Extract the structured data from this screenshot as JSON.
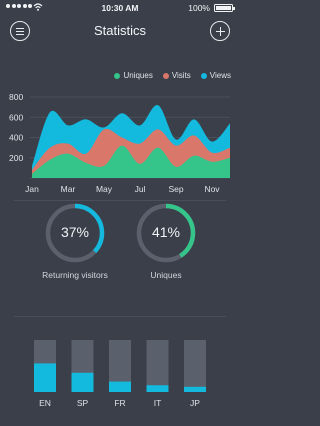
{
  "status_bar": {
    "time": "10:30 AM",
    "battery": "100%"
  },
  "nav": {
    "title": "Statistics"
  },
  "colors": {
    "background": "#3a3f4a",
    "uniques": "#35c48a",
    "visits": "#d9776a",
    "views": "#14b9de",
    "track": "#5b616c"
  },
  "legend": [
    {
      "label": "Uniques",
      "color": "#35c48a"
    },
    {
      "label": "Visits",
      "color": "#d9776a"
    },
    {
      "label": "Views",
      "color": "#14b9de"
    }
  ],
  "chart_data": [
    {
      "type": "area",
      "x_tick_labels": [
        "Jan",
        "Mar",
        "May",
        "Jul",
        "Sep",
        "Nov"
      ],
      "y_tick_labels": [
        "200",
        "400",
        "600",
        "800"
      ],
      "ylim": [
        0,
        850
      ],
      "x": [
        0,
        1,
        2,
        3,
        4,
        5,
        6,
        7,
        8,
        9,
        10,
        11
      ],
      "series": [
        {
          "name": "Views",
          "color": "#14b9de",
          "values": [
            120,
            650,
            520,
            580,
            500,
            640,
            520,
            720,
            380,
            580,
            360,
            540
          ]
        },
        {
          "name": "Visits",
          "color": "#d9776a",
          "values": [
            80,
            300,
            340,
            240,
            480,
            400,
            340,
            480,
            320,
            420,
            250,
            300
          ]
        },
        {
          "name": "Uniques",
          "color": "#35c48a",
          "values": [
            40,
            180,
            240,
            150,
            120,
            320,
            140,
            300,
            110,
            220,
            160,
            200
          ]
        }
      ],
      "grid": true
    },
    {
      "type": "donut",
      "label": "Returning visitors",
      "value": 37,
      "display": "37%"
    },
    {
      "type": "donut",
      "label": "Uniques",
      "value": 41,
      "display": "41%"
    },
    {
      "type": "bar",
      "categories": [
        "EN",
        "SP",
        "FR",
        "IT",
        "JP"
      ],
      "values": [
        55,
        37,
        20,
        13,
        10
      ],
      "ylim": [
        0,
        100
      ]
    }
  ]
}
